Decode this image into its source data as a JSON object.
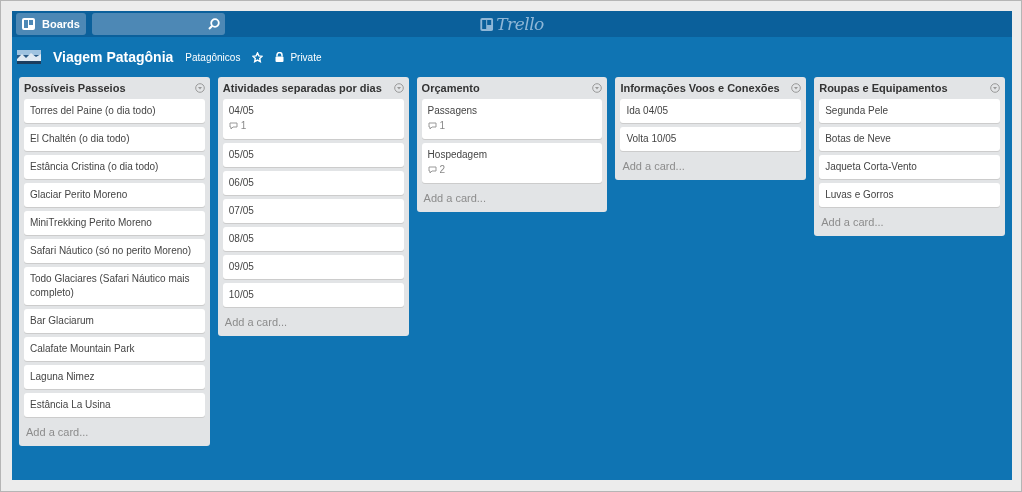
{
  "header": {
    "boards_button": "Boards",
    "logo": "Trello"
  },
  "board": {
    "title": "Viagem Patagônia",
    "team": "Patagônicos",
    "starred": false,
    "visibility": "Private"
  },
  "lists": [
    {
      "title": "Possíveis Passeios",
      "add_card": "Add a card...",
      "cards": [
        {
          "title": "Torres del Paine (o dia todo)"
        },
        {
          "title": "El Chaltén (o dia todo)"
        },
        {
          "title": "Estância Cristina (o dia todo)"
        },
        {
          "title": "Glaciar Perito Moreno"
        },
        {
          "title": "MiniTrekking Perito Moreno"
        },
        {
          "title": "Safari Náutico (só no perito Moreno)"
        },
        {
          "title": "Todo Glaciares (Safari Náutico mais completo)"
        },
        {
          "title": "Bar Glaciarum"
        },
        {
          "title": "Calafate Mountain Park"
        },
        {
          "title": "Laguna Nimez"
        },
        {
          "title": "Estância La Usina"
        }
      ]
    },
    {
      "title": "Atividades separadas por dias",
      "add_card": "Add a card...",
      "cards": [
        {
          "title": "04/05",
          "comments": "1"
        },
        {
          "title": "05/05"
        },
        {
          "title": "06/05"
        },
        {
          "title": "07/05"
        },
        {
          "title": "08/05"
        },
        {
          "title": "09/05"
        },
        {
          "title": "10/05"
        }
      ]
    },
    {
      "title": "Orçamento",
      "add_card": "Add a card...",
      "cards": [
        {
          "title": "Passagens",
          "comments": "1"
        },
        {
          "title": "Hospedagem",
          "comments": "2"
        }
      ]
    },
    {
      "title": "Informações Voos e Conexões",
      "add_card": "Add a card...",
      "cards": [
        {
          "title": "Ida 04/05"
        },
        {
          "title": "Volta 10/05"
        }
      ]
    },
    {
      "title": "Roupas e Equipamentos",
      "add_card": "Add a card...",
      "cards": [
        {
          "title": "Segunda Pele"
        },
        {
          "title": "Botas de Neve"
        },
        {
          "title": "Jaqueta Corta-Vento"
        },
        {
          "title": "Luvas e Gorros"
        }
      ]
    }
  ]
}
